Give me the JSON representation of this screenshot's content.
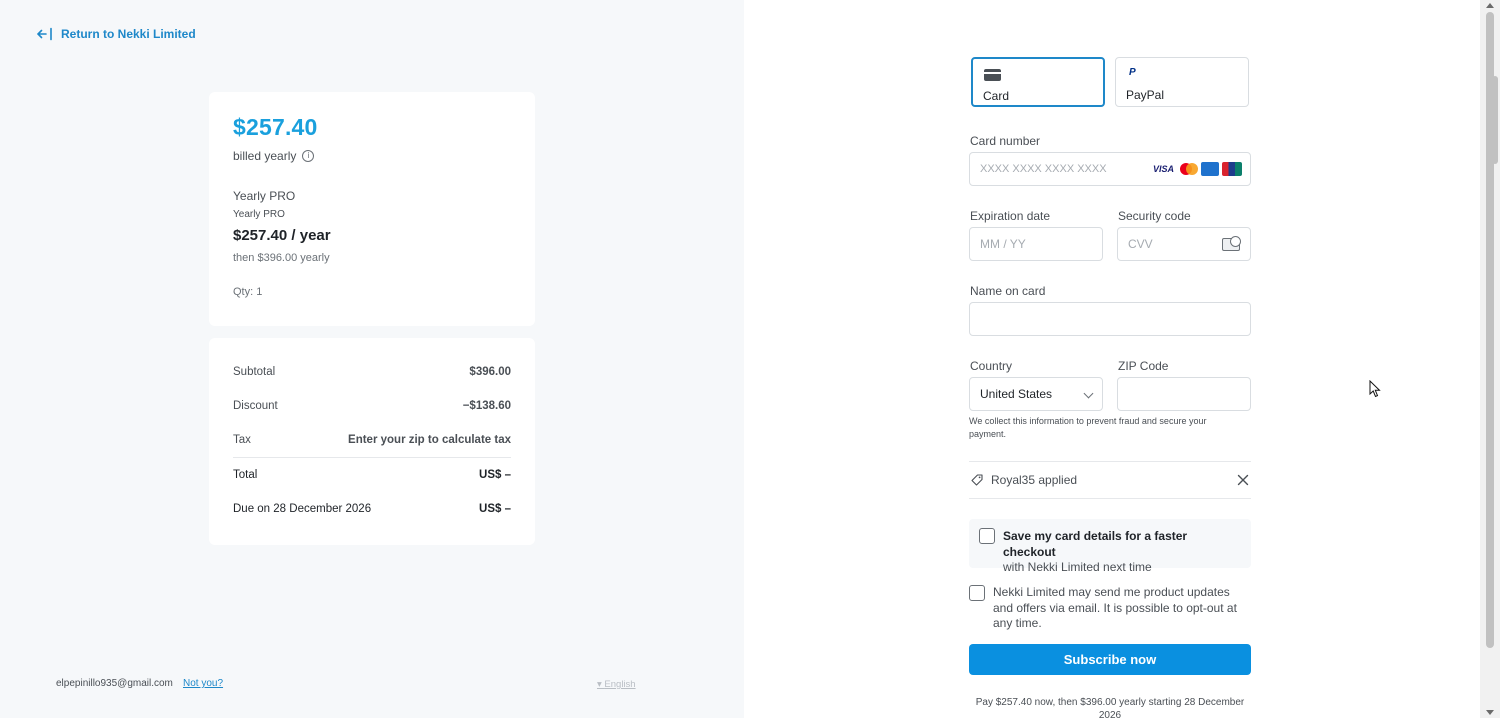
{
  "left": {
    "back_link": "Return to Nekki Limited",
    "summary": {
      "price": "$257.40",
      "billed": "billed yearly",
      "plan_name": "Yearly PRO",
      "plan_sub": "Yearly PRO",
      "plan_price": "$257.40 / year",
      "then_text": "then $396.00 yearly",
      "qty": "Qty: 1"
    },
    "totals": {
      "subtotal_label": "Subtotal",
      "subtotal_value": "$396.00",
      "discount_label": "Discount",
      "discount_value": "−$138.60",
      "tax_label": "Tax",
      "tax_value": "Enter your zip to calculate tax",
      "total_label": "Total",
      "total_value": "US$ –",
      "due_label": "Due on 28 December 2026",
      "due_value": "US$ –"
    },
    "footer": {
      "email": "elpepinillo935@gmail.com",
      "not_you": "Not you?",
      "language": "English"
    }
  },
  "right": {
    "tabs": [
      {
        "label": "Card",
        "icon": "credit-card-icon",
        "active": true
      },
      {
        "label": "PayPal",
        "icon": "paypal-icon",
        "active": false
      }
    ],
    "card_number": {
      "label": "Card number",
      "placeholder": "XXXX XXXX XXXX XXXX",
      "brands": [
        "VISA",
        "mastercard",
        "amex",
        "unionpay"
      ]
    },
    "expiration": {
      "label": "Expiration date",
      "placeholder": "MM / YY"
    },
    "security": {
      "label": "Security code",
      "placeholder": "CVV"
    },
    "name": {
      "label": "Name on card",
      "value": ""
    },
    "country": {
      "label": "Country",
      "value": "United States"
    },
    "zip": {
      "label": "ZIP Code",
      "value": ""
    },
    "fraud_note": "We collect this information to prevent fraud and secure your payment.",
    "coupon": "Royal35 applied",
    "save_card_bold": "Save my card details for a faster checkout",
    "save_card_rest": "with Nekki Limited next time",
    "updates": "Nekki Limited may send me product updates and offers via email. It is possible to opt-out at any time.",
    "subscribe": "Subscribe now",
    "pay_note": "Pay $257.40 now, then $396.00 yearly starting 28 December 2026"
  },
  "colors": {
    "accent": "#1aa0dd",
    "button": "#0a90e0",
    "link": "#1e88c9",
    "left_bg": "#f6f8fa"
  }
}
